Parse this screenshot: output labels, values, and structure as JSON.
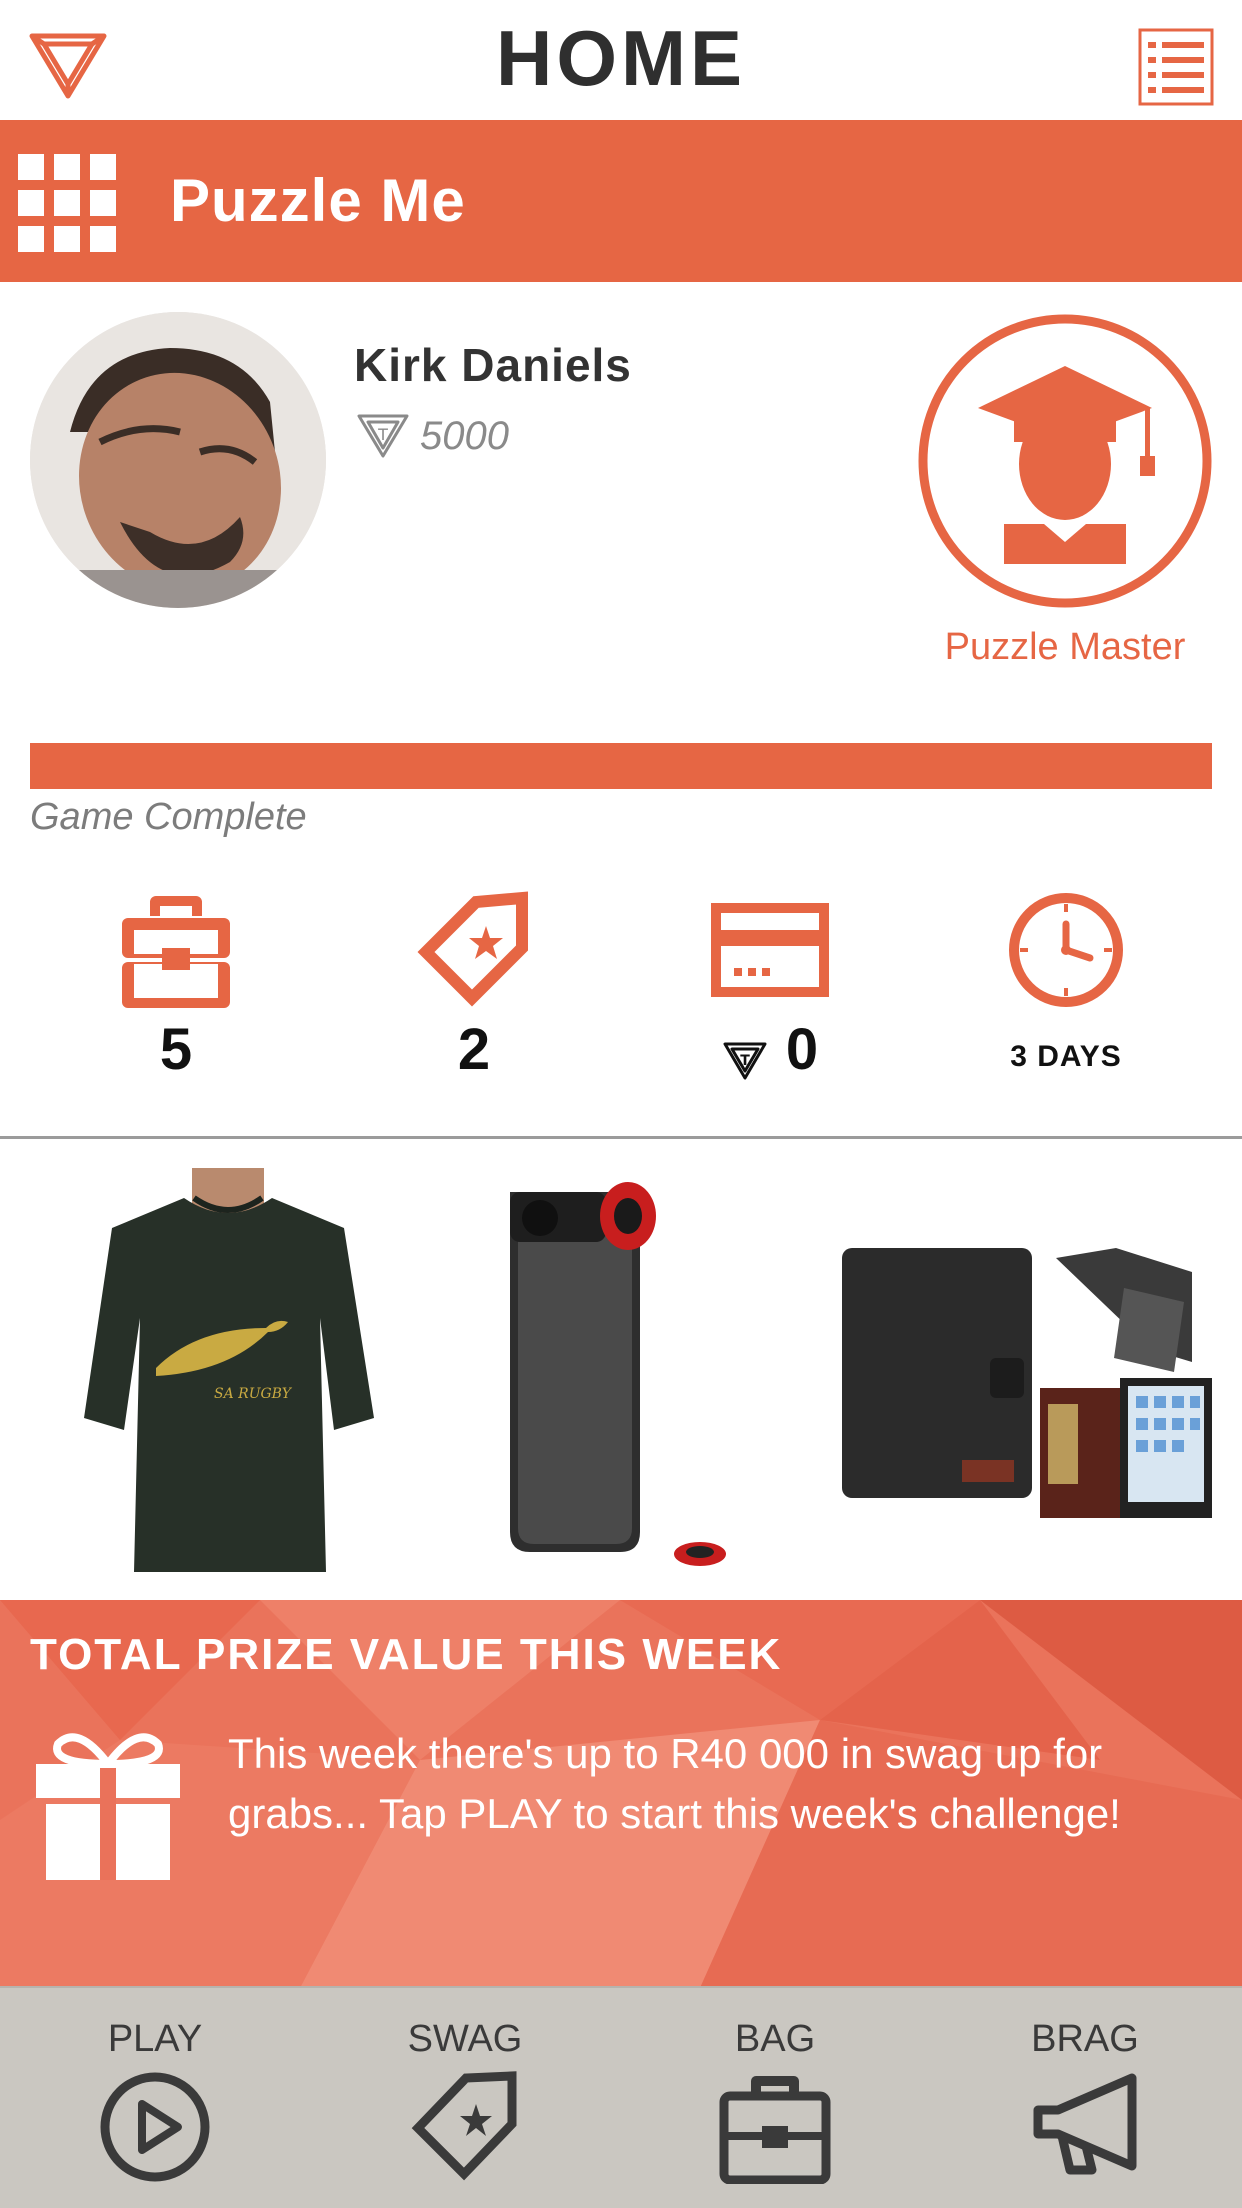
{
  "header": {
    "title": "HOME",
    "logo_icon": "vector-triangle-logo-icon",
    "menu_icon": "list-menu-icon"
  },
  "section": {
    "title": "Puzzle Me",
    "icon": "grid-icon"
  },
  "profile": {
    "name": "Kirk Daniels",
    "points": "5000",
    "points_icon": "tokens-icon",
    "badge_icon": "graduate-icon",
    "badge_label": "Puzzle Master"
  },
  "progress": {
    "value": 1.0,
    "label": "Game Complete"
  },
  "stats": [
    {
      "icon": "briefcase-icon",
      "value": "5"
    },
    {
      "icon": "tag-star-icon",
      "value": "2"
    },
    {
      "icon": "card-icon",
      "value": "0",
      "value_icon": "tokens-icon"
    },
    {
      "icon": "clock-icon",
      "value": "3 DAYS"
    }
  ],
  "products": [
    {
      "name": "t-shirt-product",
      "print": "SA RUGBY"
    },
    {
      "name": "phone-lens-product"
    },
    {
      "name": "tablet-case-product"
    }
  ],
  "promo": {
    "title": "TOTAL PRIZE VALUE THIS WEEK",
    "text": "This week there's up to R40 000 in swag up for grabs... Tap PLAY to start this week's challenge!",
    "icon": "gift-icon"
  },
  "nav": [
    {
      "label": "PLAY",
      "icon": "play-icon"
    },
    {
      "label": "SWAG",
      "icon": "tag-star-icon"
    },
    {
      "label": "BAG",
      "icon": "briefcase-icon"
    },
    {
      "label": "BRAG",
      "icon": "megaphone-icon"
    }
  ],
  "colors": {
    "accent": "#e66644",
    "promo_bg": "#ea725a",
    "nav_bg": "#cac7c1",
    "text_dark": "#333333"
  }
}
